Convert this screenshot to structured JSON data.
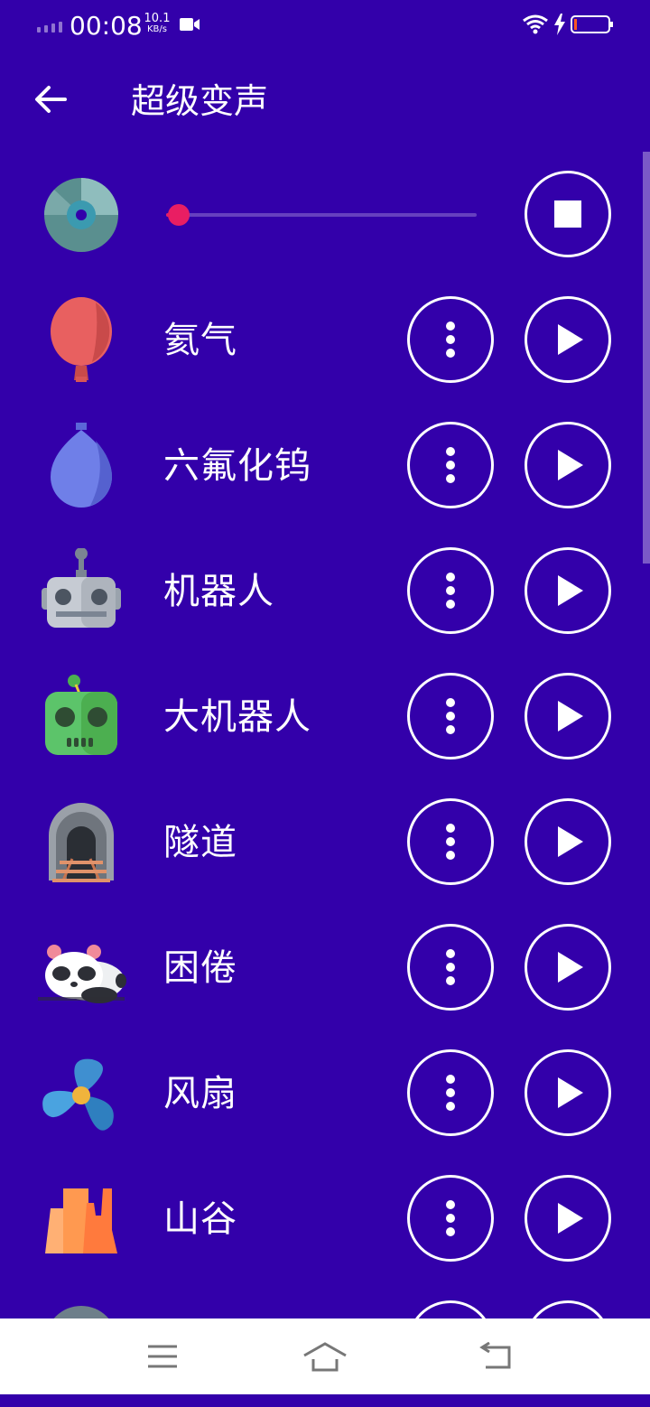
{
  "status_bar": {
    "time": "00:08",
    "net_speed_value": "10.1",
    "net_speed_unit": "KB/s",
    "icons": [
      "signal-icon",
      "video-icon",
      "wifi-icon",
      "charging-icon",
      "battery-icon"
    ]
  },
  "app_bar": {
    "title": "超级变声",
    "back_icon": "arrow-left-icon"
  },
  "player": {
    "progress": 0.04,
    "stop_icon": "stop-icon",
    "accent_color": "#e91e63"
  },
  "effects": [
    {
      "label": "氦气",
      "icon": "balloon-icon"
    },
    {
      "label": "六氟化钨",
      "icon": "water-balloon-icon"
    },
    {
      "label": "机器人",
      "icon": "robot-icon"
    },
    {
      "label": "大机器人",
      "icon": "big-robot-icon"
    },
    {
      "label": "隧道",
      "icon": "tunnel-icon"
    },
    {
      "label": "困倦",
      "icon": "sleepy-panda-icon"
    },
    {
      "label": "风扇",
      "icon": "fan-icon"
    },
    {
      "label": "山谷",
      "icon": "valley-icon"
    }
  ],
  "nav_bar": {
    "icons": [
      "menu-icon",
      "home-icon",
      "back-icon"
    ]
  },
  "colors": {
    "background": "#3300aa",
    "foreground": "#ffffff"
  }
}
